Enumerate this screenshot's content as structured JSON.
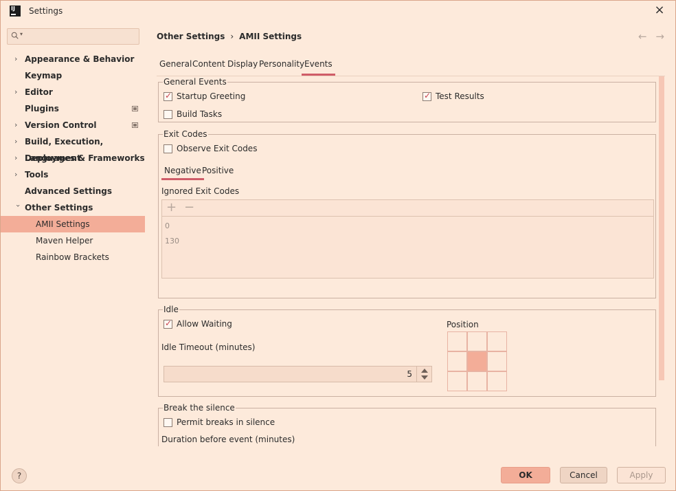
{
  "window": {
    "title": "Settings"
  },
  "search": {
    "placeholder": ""
  },
  "sidebar": {
    "items": [
      {
        "label": "Appearance & Behavior",
        "expandable": true
      },
      {
        "label": "Keymap",
        "expandable": false
      },
      {
        "label": "Editor",
        "expandable": true
      },
      {
        "label": "Plugins",
        "expandable": false,
        "badge": true
      },
      {
        "label": "Version Control",
        "expandable": true,
        "badge": true
      },
      {
        "label": "Build, Execution, Deployment",
        "expandable": true
      },
      {
        "label": "Languages & Frameworks",
        "expandable": true
      },
      {
        "label": "Tools",
        "expandable": true
      },
      {
        "label": "Advanced Settings",
        "expandable": false
      },
      {
        "label": "Other Settings",
        "expandable": true,
        "expanded": true
      },
      {
        "label": "AMII Settings",
        "child": true,
        "selected": true
      },
      {
        "label": "Maven Helper",
        "child": true
      },
      {
        "label": "Rainbow Brackets",
        "child": true
      }
    ]
  },
  "breadcrumb": {
    "parent": "Other Settings",
    "separator": "›",
    "current": "AMII Settings"
  },
  "nav": {
    "back": "←",
    "forward": "→"
  },
  "tabs": [
    "General",
    "Content",
    "Display",
    "Personality",
    "Events"
  ],
  "active_tab": "Events",
  "general_events": {
    "legend": "General Events",
    "startup_greeting": {
      "label": "Startup Greeting",
      "checked": true
    },
    "test_results": {
      "label": "Test Results",
      "checked": true
    },
    "build_tasks": {
      "label": "Build Tasks",
      "checked": false
    }
  },
  "exit_codes": {
    "legend": "Exit Codes",
    "observe": {
      "label": "Observe Exit Codes",
      "checked": false
    },
    "subtabs": [
      "Negative",
      "Positive"
    ],
    "active_subtab": "Negative",
    "ignored_label": "Ignored Exit Codes",
    "add": "+",
    "remove": "−",
    "codes": [
      "0",
      "130"
    ]
  },
  "idle": {
    "legend": "Idle",
    "allow_waiting": {
      "label": "Allow Waiting",
      "checked": true
    },
    "timeout_label": "Idle Timeout (minutes)",
    "timeout_value": "5",
    "position_label": "Position",
    "position_selected": "center"
  },
  "break_silence": {
    "legend": "Break the silence",
    "permit": {
      "label": "Permit breaks in silence",
      "checked": false
    },
    "duration_label": "Duration before event (minutes)"
  },
  "footer": {
    "help": "?",
    "ok": "OK",
    "cancel": "Cancel",
    "apply": "Apply"
  }
}
